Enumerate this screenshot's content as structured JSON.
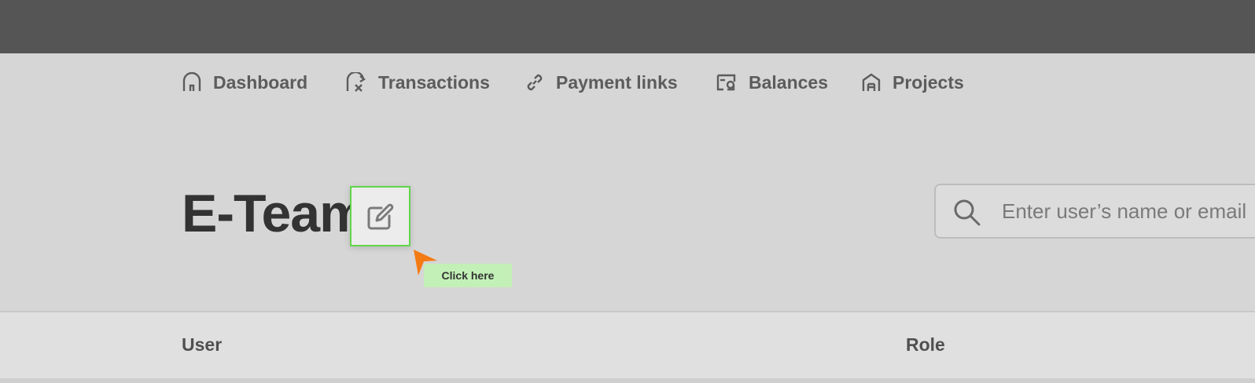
{
  "nav": {
    "items": [
      {
        "label": "Dashboard",
        "icon": "home-icon"
      },
      {
        "label": "Transactions",
        "icon": "transactions-icon"
      },
      {
        "label": "Payment links",
        "icon": "link-icon"
      },
      {
        "label": "Balances",
        "icon": "balances-icon"
      },
      {
        "label": "Projects",
        "icon": "projects-icon"
      }
    ]
  },
  "page": {
    "title": "E-Team",
    "edit_icon": "edit-icon"
  },
  "search": {
    "placeholder": "Enter user’s name or email",
    "value": ""
  },
  "annotation": {
    "label": "Click here",
    "highlight_color": "#62d44a",
    "label_bg": "#c3f0b6",
    "cursor_color": "#f47b14"
  },
  "table": {
    "columns": [
      "User",
      "Role"
    ]
  },
  "colors": {
    "topbar": "#555555",
    "background": "#d6d6d6",
    "title": "#333333"
  }
}
